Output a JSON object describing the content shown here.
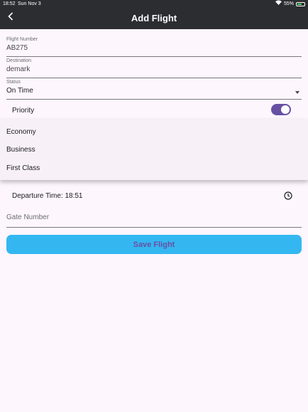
{
  "status_bar": {
    "time": "18:52",
    "date": "Sun Nov 3",
    "battery": "55%",
    "battery_level": 0.55
  },
  "app_bar": {
    "title": "Add Flight",
    "back_icon": "chevron-left-icon"
  },
  "form": {
    "flight_number": {
      "label": "Flight Number",
      "value": "AB275"
    },
    "destination": {
      "label": "Destination",
      "value": "demark"
    },
    "status": {
      "label": "Status",
      "value": "On Time"
    },
    "priority": {
      "label": "Priority",
      "enabled": true
    },
    "class_menu": {
      "options": [
        "Economy",
        "Business",
        "First Class"
      ]
    },
    "departure": {
      "text": "Departure Time: 18:51",
      "icon": "clock-icon"
    },
    "gate": {
      "placeholder": "Gate Number"
    },
    "save_label": "Save Flight"
  },
  "colors": {
    "accent": "#6750a4",
    "button": "#34b7f1",
    "appbar": "#2b2d30",
    "background": "#fdf6fd"
  }
}
